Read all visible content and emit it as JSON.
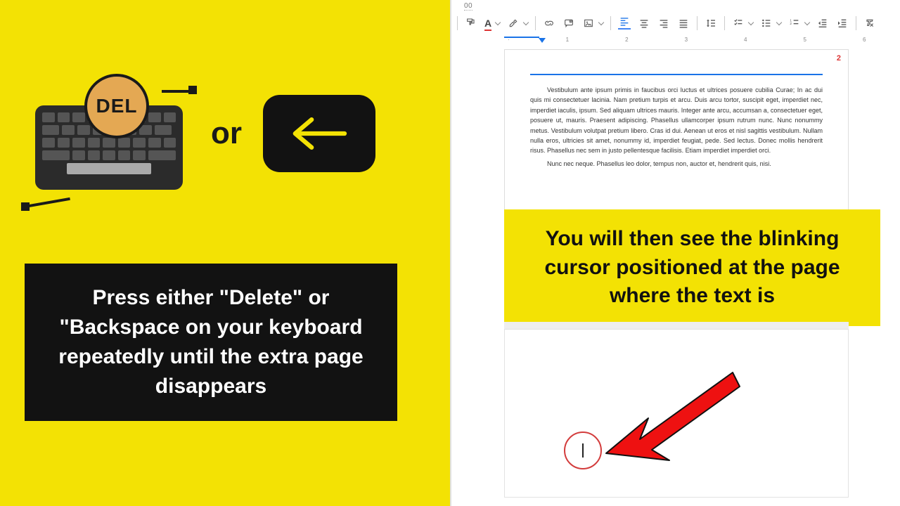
{
  "left": {
    "del_label": "DEL",
    "or_label": "or",
    "instruction": "Press either \"Delete\" or \"Backspace on your keyboard repeatedly until the extra page disappears"
  },
  "right": {
    "zoom_hint": "00",
    "page_number": "2",
    "doc_paragraph": "Vestibulum ante ipsum primis in faucibus orci luctus et ultrices posuere cubilia Curae; In ac dui quis mi consectetuer lacinia. Nam pretium turpis et arcu. Duis arcu tortor, suscipit eget, imperdiet nec, imperdiet iaculis, ipsum. Sed aliquam ultrices mauris. Integer ante arcu, accumsan a, consectetuer eget, posuere ut, mauris. Praesent adipiscing. Phasellus ullamcorper ipsum rutrum nunc. Nunc nonummy metus. Vestibulum volutpat pretium libero. Cras id dui. Aenean ut eros et nisl sagittis vestibulum. Nullam nulla eros, ultricies sit amet, nonummy id, imperdiet feugiat, pede. Sed lectus. Donec mollis hendrerit risus. Phasellus nec sem in justo pellentesque facilisis. Etiam imperdiet imperdiet orci.",
    "doc_paragraph2": "Nunc nec neque. Phasellus leo dolor, tempus non, auctor et, hendrerit quis, nisi.",
    "callout": "You will then see the blinking cursor positioned at the page where the text is",
    "toolbar": {
      "text_color_letter": "A"
    }
  }
}
